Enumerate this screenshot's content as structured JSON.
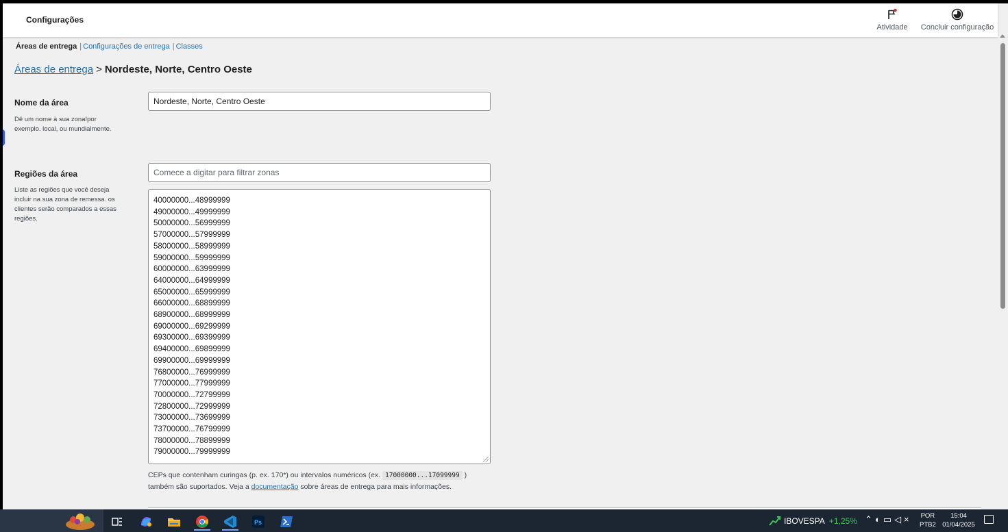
{
  "header": {
    "title": "Configurações",
    "actions": {
      "activity": {
        "label": "Atividade",
        "icon": "flag-icon"
      },
      "finish": {
        "label": "Concluir configuração",
        "icon": "progress-circle-icon"
      }
    }
  },
  "subnav": {
    "current": "Áreas de entrega",
    "links": [
      "Configurações de entrega",
      "Classes"
    ]
  },
  "breadcrumb": {
    "parent": "Áreas de entrega",
    "separator": ">",
    "current": "Nordeste, Norte, Centro Oeste"
  },
  "form": {
    "name": {
      "label": "Nome da área",
      "description": "Dê um nome à sua zona!por exemplo. local, ou mundialmente.",
      "value": "Nordeste, Norte, Centro Oeste"
    },
    "regions": {
      "label": "Regiões da área",
      "description": "Liste as regiões que você deseja incluir na sua zona de remessa. os clientes serão comparados a essas regiões.",
      "filter_placeholder": "Comece a digitar para filtrar zonas",
      "postcodes": [
        "40000000...48999999",
        "49000000...49999999",
        "50000000...56999999",
        "57000000...57999999",
        "58000000...58999999",
        "59000000...59999999",
        "60000000...63999999",
        "64000000...64999999",
        "65000000...65999999",
        "66000000...68899999",
        "68900000...68999999",
        "69000000...69299999",
        "69300000...69399999",
        "69400000...69899999",
        "69900000...69999999",
        "76800000...76999999",
        "77000000...77999999",
        "70000000...72799999",
        "72800000...72999999",
        "73000000...73699999",
        "73700000...76799999",
        "78000000...78899999",
        "79000000...79999999"
      ],
      "help": {
        "part1": "CEPs que contenham curingas (p. ex. 170*) ou intervalos numéricos (ex.",
        "code": "17000000...17099999",
        "part2": ")",
        "part3": "também são suportados. Veja a",
        "link": "documentação",
        "part4": "sobre áreas de entrega para mais informações."
      }
    }
  },
  "taskbar": {
    "apps": [
      "widgets-icon",
      "task-view-icon",
      "copilot-icon",
      "file-explorer-icon",
      "chrome-icon",
      "vscode-icon",
      "photoshop-icon",
      "powershell-icon"
    ],
    "stock": {
      "name": "IBOVESPA",
      "change": "+1,25%"
    },
    "language": {
      "line1": "POR",
      "line2": "PTB2"
    },
    "time": "15:04",
    "date": "01/04/2025"
  },
  "colors": {
    "link": "#2271b1",
    "background": "#f0f0f1",
    "taskbar": "#1c2633",
    "stock_up": "#3ec65a"
  }
}
